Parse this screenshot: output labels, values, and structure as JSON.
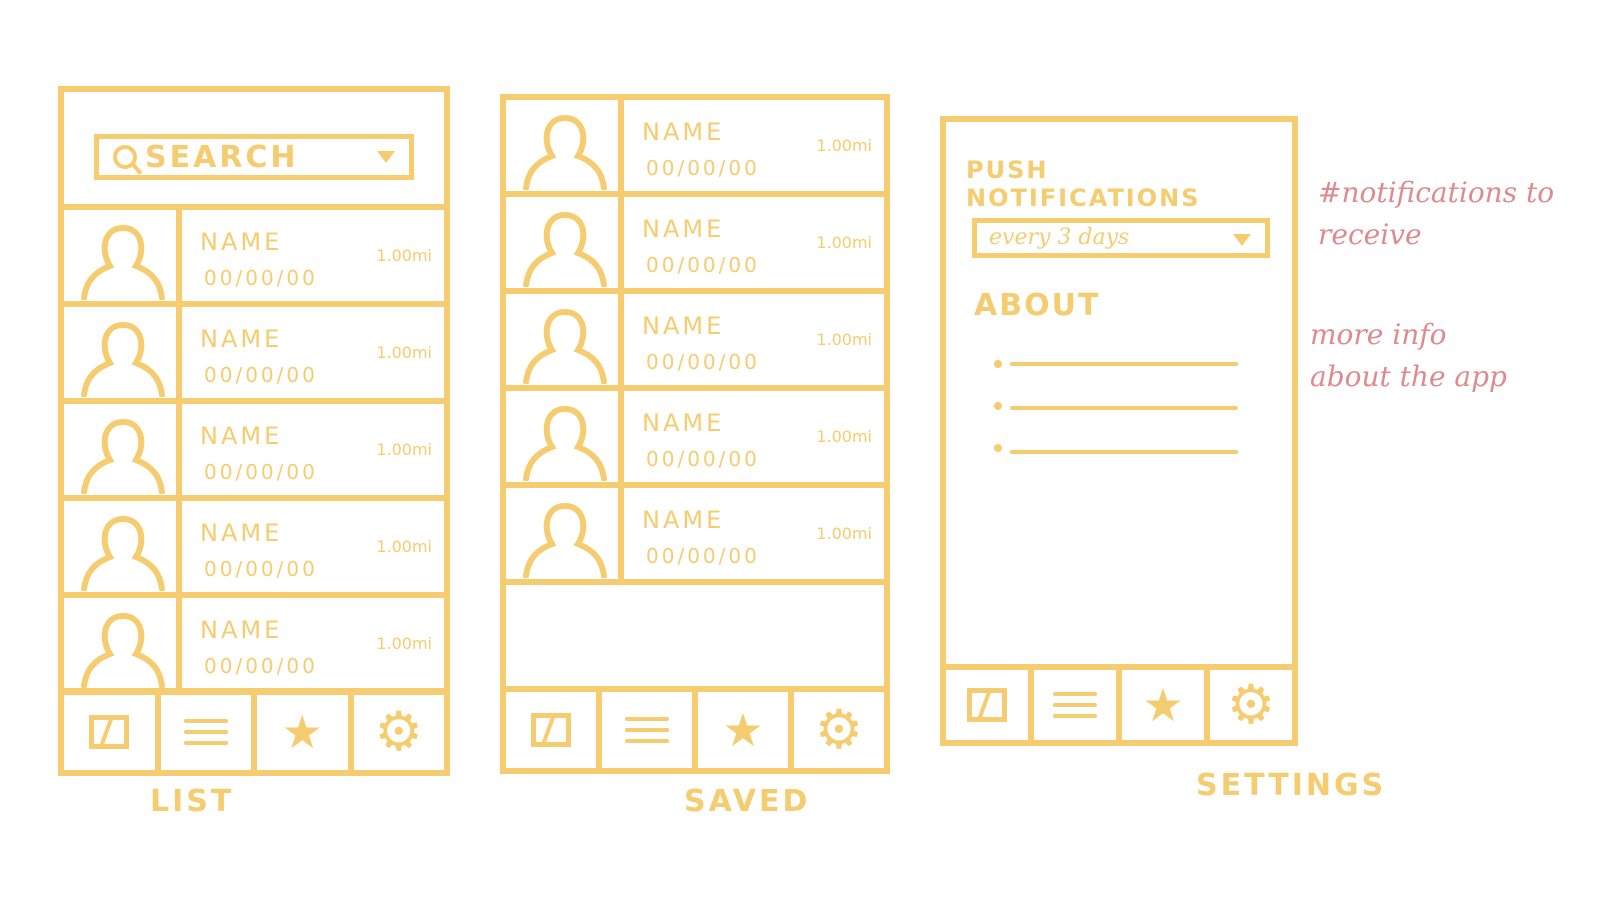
{
  "list_screen": {
    "search_placeholder": "SEARCH",
    "rows": [
      {
        "name": "NAME",
        "date": "00/00/00",
        "dist": "1.00mi"
      },
      {
        "name": "NAME",
        "date": "00/00/00",
        "dist": "1.00mi"
      },
      {
        "name": "NAME",
        "date": "00/00/00",
        "dist": "1.00mi"
      },
      {
        "name": "NAME",
        "date": "00/00/00",
        "dist": "1.00mi"
      },
      {
        "name": "NAME",
        "date": "00/00/00",
        "dist": "1.00mi"
      }
    ],
    "caption": "LIST"
  },
  "saved_screen": {
    "rows": [
      {
        "name": "NAME",
        "date": "00/00/00",
        "dist": "1.00mi"
      },
      {
        "name": "NAME",
        "date": "00/00/00",
        "dist": "1.00mi"
      },
      {
        "name": "NAME",
        "date": "00/00/00",
        "dist": "1.00mi"
      },
      {
        "name": "NAME",
        "date": "00/00/00",
        "dist": "1.00mi"
      },
      {
        "name": "NAME",
        "date": "00/00/00",
        "dist": "1.00mi"
      }
    ],
    "caption": "SAVED"
  },
  "settings_screen": {
    "push_label": "PUSH NOTIFICATIONS",
    "frequency_value": "every 3 days",
    "about_label": "ABOUT",
    "caption": "SETTINGS"
  },
  "annotations": {
    "notifications_note": "#notifications to receive",
    "about_note": "more info about the app"
  },
  "colors": {
    "sketch": "#f5cc6f",
    "annotation": "#df8a8f"
  },
  "icons": [
    "map-icon",
    "list-icon",
    "star-icon",
    "gear-icon"
  ]
}
